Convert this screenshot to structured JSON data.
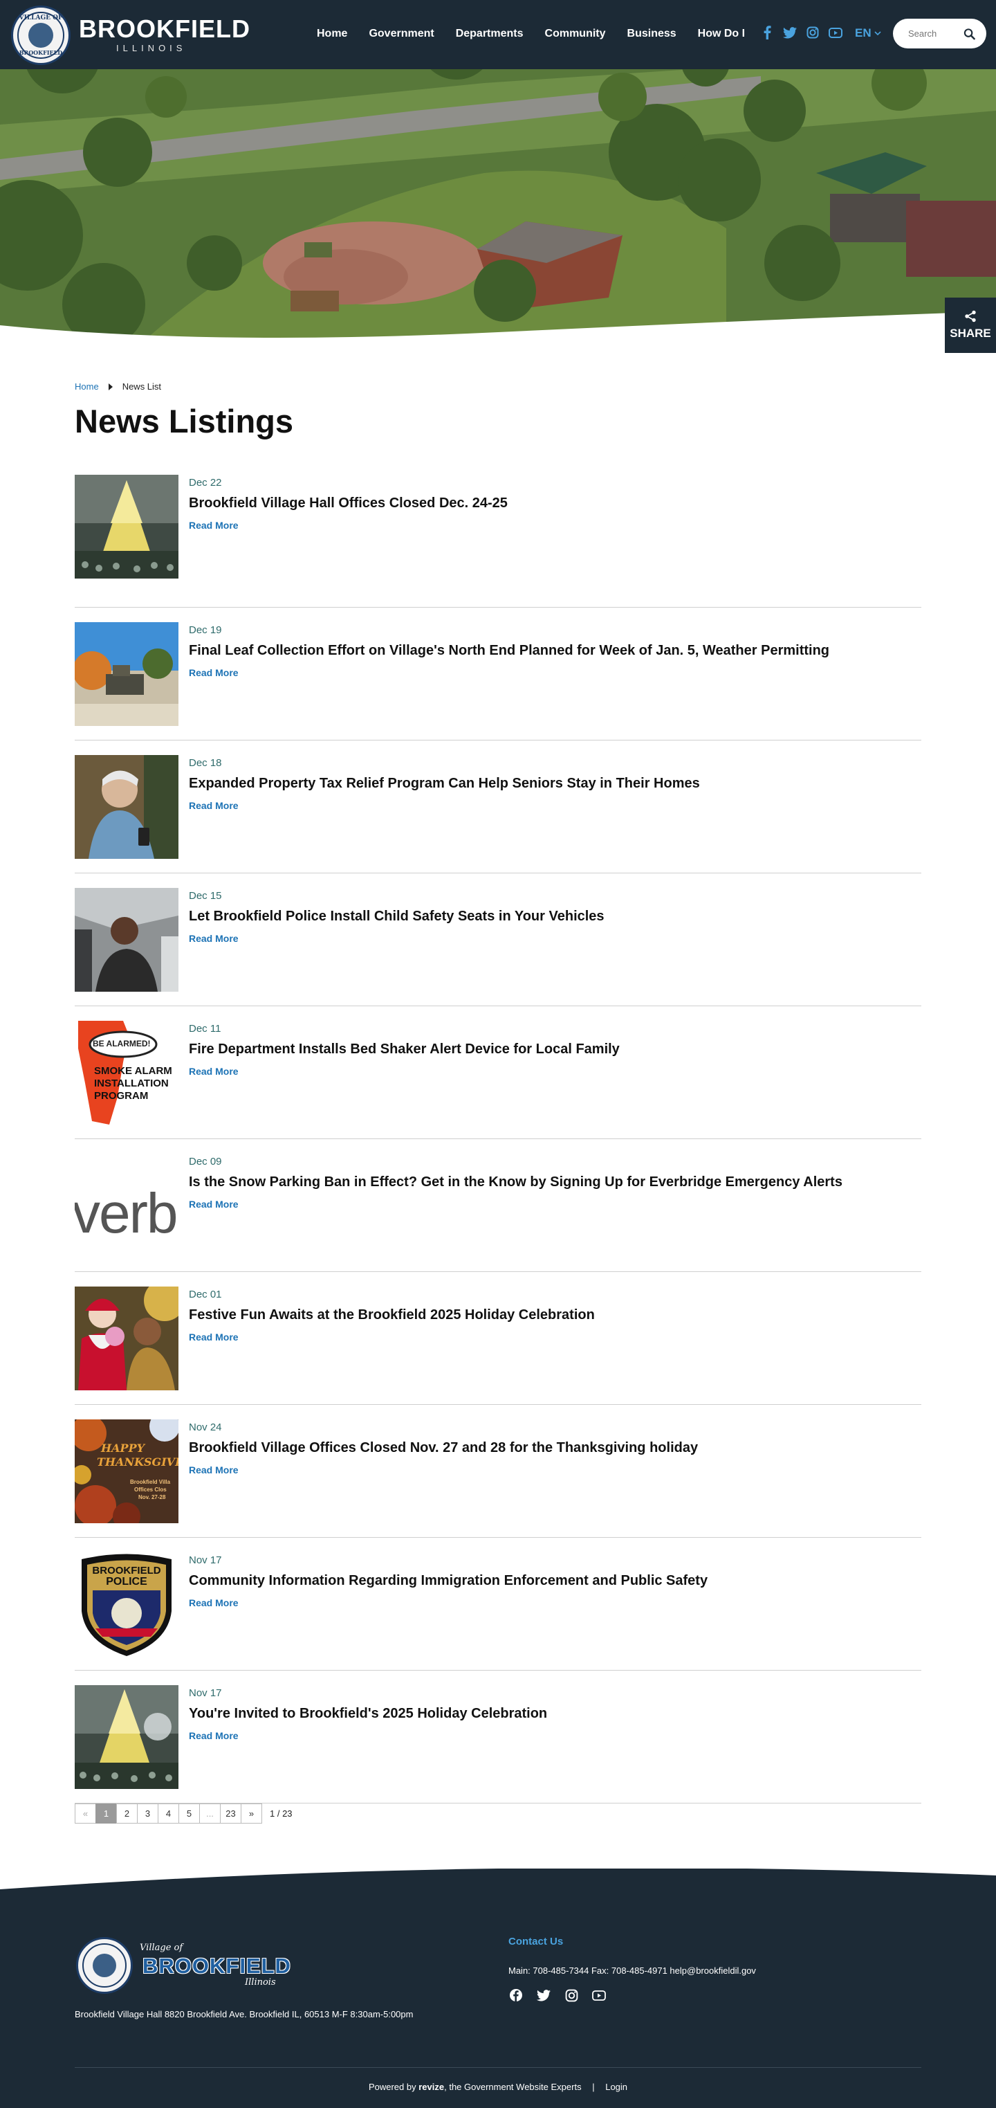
{
  "header": {
    "logo_name": "BROOKFIELD",
    "logo_sub": "ILLINOIS",
    "seal_top": "VILLAGE OF",
    "seal_bottom": "BROOKFIELD",
    "nav": [
      "Home",
      "Government",
      "Departments",
      "Community",
      "Business",
      "How Do I"
    ],
    "language": "EN",
    "search_placeholder": "Search",
    "social_icons": [
      "facebook-icon",
      "twitter-icon",
      "instagram-icon",
      "youtube-icon"
    ],
    "accent_color": "#4aa3df",
    "bg_color": "#1c2a36"
  },
  "share": {
    "label": "SHARE"
  },
  "breadcrumb": {
    "home": "Home",
    "current": "News List"
  },
  "page_title": "News Listings",
  "read_more": "Read More",
  "news": [
    {
      "date": "Dec 22",
      "title": "Brookfield Village Hall Offices Closed Dec. 24-25"
    },
    {
      "date": "Dec 19",
      "title": "Final Leaf Collection Effort on Village's North End Planned for Week of Jan. 5, Weather Permitting"
    },
    {
      "date": "Dec 18",
      "title": "Expanded Property Tax Relief Program Can Help Seniors Stay in Their Homes"
    },
    {
      "date": "Dec 15",
      "title": "Let Brookfield Police Install Child Safety Seats in Your Vehicles"
    },
    {
      "date": "Dec 11",
      "title": "Fire Department Installs Bed Shaker Alert Device for Local Family"
    },
    {
      "date": "Dec 09",
      "title": "Is the Snow Parking Ban in Effect? Get in the Know by Signing Up for Everbridge Emergency Alerts"
    },
    {
      "date": "Dec 01",
      "title": "Festive Fun Awaits at the Brookfield 2025 Holiday Celebration"
    },
    {
      "date": "Nov 24",
      "title": "Brookfield Village Offices Closed Nov. 27 and 28 for the Thanksgiving holiday"
    },
    {
      "date": "Nov 17",
      "title": "Community Information Regarding Immigration Enforcement and Public Safety"
    },
    {
      "date": "Nov 17",
      "title": "You're Invited to Brookfield's 2025 Holiday Celebration"
    }
  ],
  "thumb_text": {
    "smoke_alarm_1": "BE ALARMED!",
    "smoke_alarm_2": "SMOKE ALARM",
    "smoke_alarm_3": "INSTALLATION",
    "smoke_alarm_4": "PROGRAM",
    "everbridge": "verb",
    "thanks_1": "HAPPY",
    "thanks_2": "THANKSGIVI",
    "thanks_3": "Brookfield Villa",
    "thanks_4": "Offices Clos",
    "thanks_5": "Nov. 27-28",
    "police_1": "BROOKFIELD",
    "police_2": "POLICE"
  },
  "pagination": {
    "prev": "«",
    "pages": [
      "1",
      "2",
      "3",
      "4",
      "5",
      "...",
      "23"
    ],
    "next": "»",
    "count": "1 / 23",
    "current": "1"
  },
  "footer": {
    "village_of": "Village of",
    "name": "BROOKFIELD",
    "state": "Illinois",
    "address": "Brookfield Village Hall 8820 Brookfield Ave. Brookfield IL, 60513 M-F 8:30am-5:00pm",
    "contact_heading": "Contact Us",
    "contact_line": "Main: 708-485-7344 Fax: 708-485-4971 help@brookfieldil.gov",
    "social_icons": [
      "facebook-icon",
      "twitter-icon",
      "instagram-icon",
      "youtube-icon"
    ],
    "powered_prefix": "Powered by",
    "powered_brand": "revize",
    "powered_suffix": ", the Government Website Experts",
    "login": "Login",
    "bg_color": "#1c2a36"
  }
}
